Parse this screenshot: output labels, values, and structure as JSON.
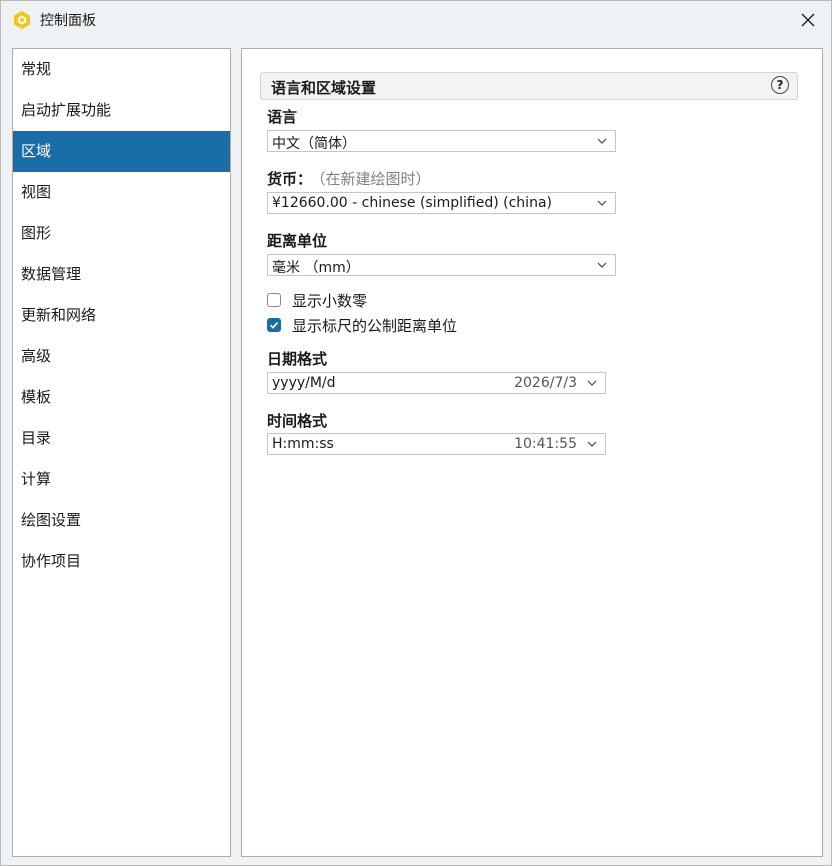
{
  "window": {
    "title": "控制面板"
  },
  "sidebar": {
    "items": [
      {
        "label": "常规"
      },
      {
        "label": "启动扩展功能"
      },
      {
        "label": "区域"
      },
      {
        "label": "视图"
      },
      {
        "label": "图形"
      },
      {
        "label": "数据管理"
      },
      {
        "label": "更新和网络"
      },
      {
        "label": "高级"
      },
      {
        "label": "模板"
      },
      {
        "label": "目录"
      },
      {
        "label": "计算"
      },
      {
        "label": "绘图设置"
      },
      {
        "label": "协作项目"
      }
    ],
    "selected": "区域"
  },
  "main": {
    "section_title": "语言和区域设置",
    "help_glyph": "?",
    "language": {
      "label": "语言",
      "value": "中文（简体）"
    },
    "currency": {
      "label": "货币：",
      "note": "（在新建绘图时）",
      "value": "¥12660.00 - chinese (simplified) (china)"
    },
    "distance": {
      "label": "距离单位",
      "value": "毫米 （mm）"
    },
    "checkboxes": {
      "show_decimal_zero": {
        "label": "显示小数零",
        "checked": false
      },
      "show_metric_ruler": {
        "label": "显示标尺的公制距离单位",
        "checked": true
      }
    },
    "date_format": {
      "label": "日期格式",
      "value": "yyyy/M/d",
      "sample": "2026/7/3"
    },
    "time_format": {
      "label": "时间格式",
      "value": "H:mm:ss",
      "sample": "10:41:55"
    }
  },
  "colors": {
    "accent": "#1a6ea8",
    "app_icon": "#f5c518"
  },
  "icons": [
    "app-hexagon-icon",
    "close-icon",
    "help-icon",
    "chevron-down-icon",
    "check-icon"
  ]
}
